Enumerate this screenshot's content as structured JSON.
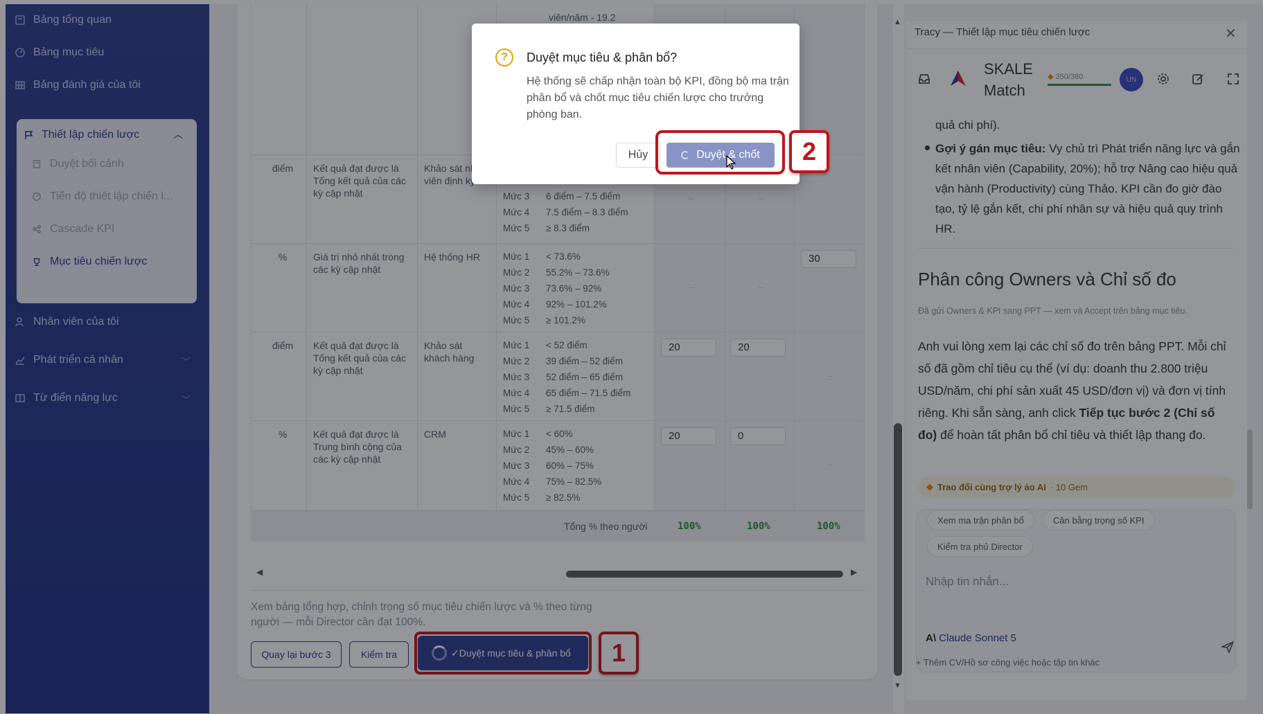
{
  "sidebar": {
    "items": [
      {
        "label": "Bảng tổng quan"
      },
      {
        "label": "Bảng mục tiêu"
      },
      {
        "label": "Bảng đánh giá của tôi"
      }
    ],
    "group": {
      "label": "Thiết lập chiến lược",
      "sub_items": [
        {
          "label": "Duyệt bối cảnh"
        },
        {
          "label": "Tiến độ thiết lập chiến l..."
        },
        {
          "label": "Cascade KPI"
        },
        {
          "label": "Mục tiêu chiến lược"
        }
      ]
    },
    "more_items": [
      {
        "label": "Nhân viên của tôi"
      },
      {
        "label": "Phát triển cá nhân"
      },
      {
        "label": "Từ điển năng lực"
      }
    ]
  },
  "table": {
    "top_fragment": "viên/năm - 19.2",
    "rows": [
      {
        "unit": "điểm",
        "method": "Kết quả đạt được là Tổng kết quả của các kỳ cập nhật",
        "source": "Khảo sát nhân viên định kỳ",
        "levels": [
          {
            "name": "Mức 3",
            "range": "6 điểm – 7.5 điểm"
          },
          {
            "name": "Mức 4",
            "range": "7.5 điểm – 8.3 điểm"
          },
          {
            "name": "Mức 5",
            "range": "≥ 8.3 điểm"
          }
        ]
      },
      {
        "unit": "%",
        "method": "Giá trị nhỏ nhất trong các kỳ cập nhật",
        "source": "Hệ thống HR",
        "levels": [
          {
            "name": "Mức 1",
            "range": "< 73.6%"
          },
          {
            "name": "Mức 2",
            "range": "55.2% – 73.6%"
          },
          {
            "name": "Mức 3",
            "range": "73.6% – 92%"
          },
          {
            "name": "Mức 4",
            "range": "92% – 101.2%"
          },
          {
            "name": "Mức 5",
            "range": "≥ 101.2%"
          }
        ],
        "input3": "30"
      },
      {
        "unit": "điểm",
        "method": "Kết quả đạt được là Tổng kết quả của các kỳ cập nhật",
        "source": "Khảo sát khách hàng",
        "levels": [
          {
            "name": "Mức 1",
            "range": "< 52 điểm"
          },
          {
            "name": "Mức 2",
            "range": "39 điểm – 52 điểm"
          },
          {
            "name": "Mức 3",
            "range": "52 điểm – 65 điểm"
          },
          {
            "name": "Mức 4",
            "range": "65 điểm – 71.5 điểm"
          },
          {
            "name": "Mức 5",
            "range": "≥ 71.5 điểm"
          }
        ],
        "input1": "20",
        "input2": "20"
      },
      {
        "unit": "%",
        "method": "Kết quả đạt được là Trung bình cộng của các kỳ cập nhật",
        "source": "CRM",
        "levels": [
          {
            "name": "Mức 1",
            "range": "< 60%"
          },
          {
            "name": "Mức 2",
            "range": "45% – 60%"
          },
          {
            "name": "Mức 3",
            "range": "60% – 75%"
          },
          {
            "name": "Mức 4",
            "range": "75% – 82.5%"
          },
          {
            "name": "Mức 5",
            "range": "≥ 82.5%"
          }
        ],
        "input1": "20",
        "input2": "0"
      }
    ],
    "dash": "–",
    "total_label": "Tổng % theo người",
    "totals": [
      "100%",
      "100%",
      "100%"
    ]
  },
  "footer": {
    "note": "Xem bảng tổng hợp, chỉnh trọng số mục tiêu chiến lược và % theo từng người — mỗi Director cần đạt 100%.",
    "back_label": "Quay lại bước 3",
    "check_label": "Kiểm tra",
    "approve_label": "✓Duyệt mục tiêu & phân bổ"
  },
  "badges": {
    "one": "1",
    "two": "2"
  },
  "dialog": {
    "title": "Duyệt mục tiêu & phân bổ?",
    "body": "Hệ thống sẽ chấp nhận toàn bộ KPI, đồng bộ ma trận phân bổ và chốt mục tiêu chiến lược cho trưởng phòng ban.",
    "cancel_label": "Hủy",
    "confirm_label": "Duyệt & chốt",
    "question_mark": "?"
  },
  "chat": {
    "title": "Tracy — Thiết lập mục tiêu chiến lược",
    "brand": "SKALE Match",
    "gem_counter": "350/380",
    "avatar_initials": "UN",
    "bullet_tail": "quả chi phí).",
    "bullet_bold": "Gợi ý gán mục tiêu:",
    "bullet_text": " Vy chủ trì Phát triển năng lực và gắn kết nhân viên (Capability, 20%); hỗ trợ Nâng cao hiệu quả vận hành (Productivity) cùng Thảo. KPI cần đo giờ đào tạo, tỷ lệ gắn kết, chi phí nhân sự và hiệu quả quy trình HR.",
    "heading": "Phân công Owners và Chỉ số đo",
    "sub_note": "Đã gửi Owners & KPI sang PPT — xem và Accept trên bảng mục tiêu.",
    "para_1": "Anh vui lòng xem lại các chỉ số đo trên bảng PPT. Mỗi chỉ số đã gồm chỉ tiêu cụ thể (ví dụ: doanh thu 2.800 triệu USD/năm, chi phí sản xuất 45 USD/đơn vị) và đơn vị tính riêng. Khi sẵn sàng, anh click ",
    "para_bold": "Tiếp tục bước 2 (Chỉ số đo)",
    "para_2": " để hoàn tất phân bổ chỉ tiêu và thiết lập thang đo.",
    "ai_chip": "Trao đổi cùng trợ lý ảo AI",
    "ai_cost": "· 10 Gem",
    "quick_replies": [
      "Xem ma trận phân bổ",
      "Cân bằng trọng số KPI",
      "Kiểm tra phủ Director"
    ],
    "placeholder": "Nhập tin nhắn...",
    "model": "Claude Sonnet 5",
    "attach": "+ Thêm CV/Hồ sơ công việc hoặc tập tin khác"
  }
}
